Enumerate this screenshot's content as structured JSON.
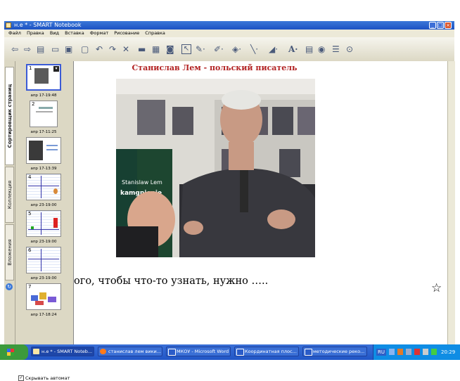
{
  "window": {
    "title": "н.е * - SMART Notebook"
  },
  "menu": [
    "Файл",
    "Правка",
    "Вид",
    "Вставка",
    "Формат",
    "Рисование",
    "Справка"
  ],
  "side_tabs": {
    "sorter": "Сортировщик страниц",
    "gallery": "Коллекция",
    "attachments": "Вложения"
  },
  "pages": [
    {
      "num": "1",
      "date": "апр 17-19:48"
    },
    {
      "num": "2",
      "date": "апр 17-11:25"
    },
    {
      "num": "",
      "date": "апр 17-13:39"
    },
    {
      "num": "4",
      "date": "апр 23-19:00"
    },
    {
      "num": "5",
      "date": "апр 23-19:00"
    },
    {
      "num": "6",
      "date": "апр 23-19:00"
    },
    {
      "num": "7",
      "date": "апр 17-18:24"
    }
  ],
  "sorter": {
    "autohide_label": "Скрывать автомат"
  },
  "slide": {
    "title": "Станислав Лем - польский писатель",
    "text": "ого, чтобы что-то узнать, нужно …..",
    "book_text_1": "Stanislaw Lem",
    "book_text_2": "kamgnienie"
  },
  "taskbar": {
    "items": [
      "н.е * - SMART Noteb...",
      "станислав лем вики...",
      "МКОУ - Microsoft Word",
      "Координатная плос...",
      "методические реко..."
    ],
    "language": "RU",
    "clock": "20:29"
  },
  "colors": {
    "title_red": "#b22222",
    "taskbar_blue": "#2156c7",
    "selection_blue": "#3b5bd6"
  }
}
